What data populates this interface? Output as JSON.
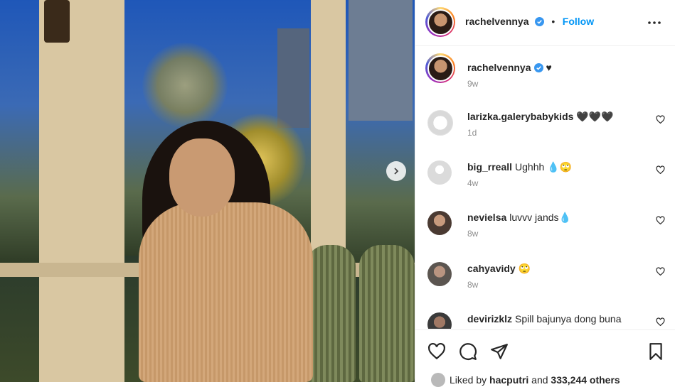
{
  "post": {
    "username": "rachelvennya",
    "follow_label": "Follow",
    "separator": "•",
    "caption": "♥",
    "caption_time": "9w"
  },
  "comments": [
    {
      "user": "larizka.galerybabykids",
      "text": "🖤🖤🖤",
      "time": "1d"
    },
    {
      "user": "big_rreall",
      "text": "Ughhh 💧🙄",
      "time": "4w"
    },
    {
      "user": "nevielsa",
      "text": "luvvv jands💧",
      "time": "8w"
    },
    {
      "user": "cahyavidy",
      "text": "🙄",
      "time": "8w"
    },
    {
      "user": "devirizklz",
      "text": "Spill bajunya dong buna",
      "time": ""
    }
  ],
  "likes": {
    "prefix": "Liked by",
    "user": "hacputri",
    "and_text": "and",
    "count_text": "333,244 others"
  },
  "colors": {
    "accent": "#0095f6",
    "verified": "#3897f0",
    "muted": "#8e8e8e"
  },
  "icons": [
    "verified-badge-icon",
    "more-options-icon",
    "heart-icon",
    "comment-icon",
    "share-icon",
    "bookmark-icon",
    "chevron-right-icon"
  ]
}
